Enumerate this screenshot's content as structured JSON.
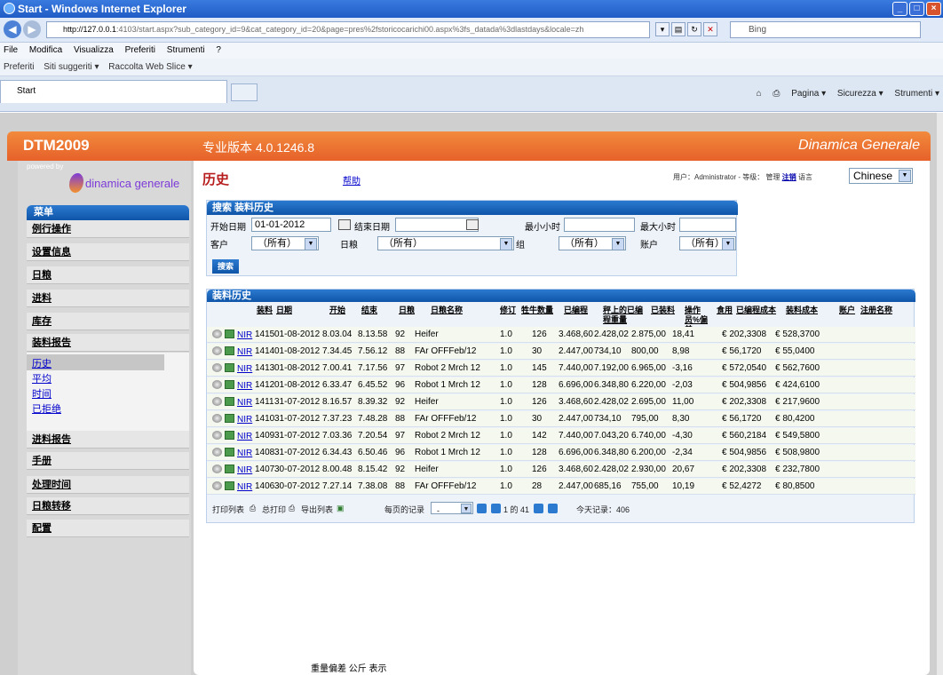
{
  "browser": {
    "window_title": "Start - Windows Internet Explorer",
    "url_host": "http://127.0.0.1",
    "url_rest": ":4103/start.aspx?sub_category_id=9&cat_category_id=20&page=pres%2fstoricocarichi00.aspx%3fs_datada%3dlastdays&locale=zh",
    "search_placeholder": "Bing",
    "menu": [
      "File",
      "Modifica",
      "Visualizza",
      "Preferiti",
      "Strumenti",
      "?"
    ],
    "favorites": [
      "Preferiti",
      "Siti suggeriti ▾",
      "Raccolta Web Slice ▾"
    ],
    "tab_label": "Start",
    "commands": [
      "Pagina ▾",
      "Sicurezza ▾",
      "Strumenti ▾"
    ]
  },
  "app": {
    "title": "DTM2009",
    "edition": "专业版本 4.0.1246.8",
    "brand": "Dinamica Generale",
    "powered_by": "powered by",
    "logo_text": "dinamica generale"
  },
  "sidebar": {
    "header": "菜单",
    "items": [
      "例行操作",
      "设置信息",
      "日粮",
      "进料",
      "库存",
      "装料报告",
      "进料报告",
      "手册",
      "处理时间",
      "日粮转移",
      "配置"
    ],
    "sub_items": [
      "历史",
      "平均",
      "时间",
      "已拒绝"
    ]
  },
  "page": {
    "title": "历史",
    "help": "帮助",
    "user_prefix": "用户：",
    "user": "Administrator",
    "level_label": "- 等级：",
    "level": "管理",
    "logout": "注销",
    "lang_label": "语言",
    "language": "Chinese"
  },
  "search": {
    "header": "搜索 装料历史",
    "start_date_label": "开始日期",
    "start_date": "01-01-2012",
    "end_date_label": "结束日期",
    "end_date": "",
    "min_hour_label": "最小小时",
    "max_hour_label": "最大小时",
    "customer_label": "客户",
    "customer": "（所有）",
    "ration_label": "日粮",
    "ration": "（所有）",
    "group_label": "组",
    "group": "（所有）",
    "account_label": "账户",
    "account": "（所有）",
    "button": "搜索"
  },
  "history": {
    "header": "装料历史",
    "columns": [
      "装料",
      "日期",
      "开始",
      "结束",
      "日粮",
      "日粮名称",
      "修订",
      "牲牛数量",
      "已编程",
      "秤上的已编程重量",
      "已装料",
      "操作员%偏差",
      "食用",
      "已编程成本",
      "装料成本",
      "账户",
      "注册名称"
    ],
    "rows": [
      {
        "link": "NIR",
        "id": "1415",
        "date": "01-08-2012",
        "start": "8.03.04",
        "end": "8.13.58",
        "ration": "92",
        "name": "Heifer",
        "rev": "1.0",
        "heads": "126",
        "prog": "3.468,60",
        "scale": "2.428,02",
        "loaded": "2.875,00",
        "dev": "18,41",
        "pcost": "€ 202,3308",
        "lcost": "€ 528,3700"
      },
      {
        "link": "NIR",
        "id": "1414",
        "date": "01-08-2012",
        "start": "7.34.45",
        "end": "7.56.12",
        "ration": "88",
        "name": "FAr OFFFeb/12",
        "rev": "1.0",
        "heads": "30",
        "prog": "2.447,00",
        "scale": "734,10",
        "loaded": "800,00",
        "dev": "8,98",
        "pcost": "€ 56,1720",
        "lcost": "€ 55,0400"
      },
      {
        "link": "NIR",
        "id": "1413",
        "date": "01-08-2012",
        "start": "7.00.41",
        "end": "7.17.56",
        "ration": "97",
        "name": "Robot 2 Mrch 12",
        "rev": "1.0",
        "heads": "145",
        "prog": "7.440,00",
        "scale": "7.192,00",
        "loaded": "6.965,00",
        "dev": "-3,16",
        "pcost": "€ 572,0540",
        "lcost": "€ 562,7600"
      },
      {
        "link": "NIR",
        "id": "1412",
        "date": "01-08-2012",
        "start": "6.33.47",
        "end": "6.45.52",
        "ration": "96",
        "name": "Robot 1 Mrch 12",
        "rev": "1.0",
        "heads": "128",
        "prog": "6.696,00",
        "scale": "6.348,80",
        "loaded": "6.220,00",
        "dev": "-2,03",
        "pcost": "€ 504,9856",
        "lcost": "€ 424,6100"
      },
      {
        "link": "NIR",
        "id": "1411",
        "date": "31-07-2012",
        "start": "8.16.57",
        "end": "8.39.32",
        "ration": "92",
        "name": "Heifer",
        "rev": "1.0",
        "heads": "126",
        "prog": "3.468,60",
        "scale": "2.428,02",
        "loaded": "2.695,00",
        "dev": "11,00",
        "pcost": "€ 202,3308",
        "lcost": "€ 217,9600"
      },
      {
        "link": "NIR",
        "id": "1410",
        "date": "31-07-2012",
        "start": "7.37.23",
        "end": "7.48.28",
        "ration": "88",
        "name": "FAr OFFFeb/12",
        "rev": "1.0",
        "heads": "30",
        "prog": "2.447,00",
        "scale": "734,10",
        "loaded": "795,00",
        "dev": "8,30",
        "pcost": "€ 56,1720",
        "lcost": "€ 80,4200"
      },
      {
        "link": "NIR",
        "id": "1409",
        "date": "31-07-2012",
        "start": "7.03.36",
        "end": "7.20.54",
        "ration": "97",
        "name": "Robot 2 Mrch 12",
        "rev": "1.0",
        "heads": "142",
        "prog": "7.440,00",
        "scale": "7.043,20",
        "loaded": "6.740,00",
        "dev": "-4,30",
        "pcost": "€ 560,2184",
        "lcost": "€ 549,5800"
      },
      {
        "link": "NIR",
        "id": "1408",
        "date": "31-07-2012",
        "start": "6.34.43",
        "end": "6.50.46",
        "ration": "96",
        "name": "Robot 1 Mrch 12",
        "rev": "1.0",
        "heads": "128",
        "prog": "6.696,00",
        "scale": "6.348,80",
        "loaded": "6.200,00",
        "dev": "-2,34",
        "pcost": "€ 504,9856",
        "lcost": "€ 508,9800"
      },
      {
        "link": "NIR",
        "id": "1407",
        "date": "30-07-2012",
        "start": "8.00.48",
        "end": "8.15.42",
        "ration": "92",
        "name": "Heifer",
        "rev": "1.0",
        "heads": "126",
        "prog": "3.468,60",
        "scale": "2.428,02",
        "loaded": "2.930,00",
        "dev": "20,67",
        "pcost": "€ 202,3308",
        "lcost": "€ 232,7800"
      },
      {
        "link": "NIR",
        "id": "1406",
        "date": "30-07-2012",
        "start": "7.27.14",
        "end": "7.38.08",
        "ration": "88",
        "name": "FAr OFFFeb/12",
        "rev": "1.0",
        "heads": "28",
        "prog": "2.447,00",
        "scale": "685,16",
        "loaded": "755,00",
        "dev": "10,19",
        "pcost": "€ 52,4272",
        "lcost": "€ 80,8500"
      }
    ],
    "footer": {
      "print_list": "打印列表",
      "print_all": "总打印",
      "export_list": "导出列表",
      "per_page": "每页的记录",
      "per_page_value": "-",
      "page_info": "1 的 41",
      "today_records": "今天记录：406"
    }
  },
  "bottom_text": "重量偏差 公斤 表示"
}
